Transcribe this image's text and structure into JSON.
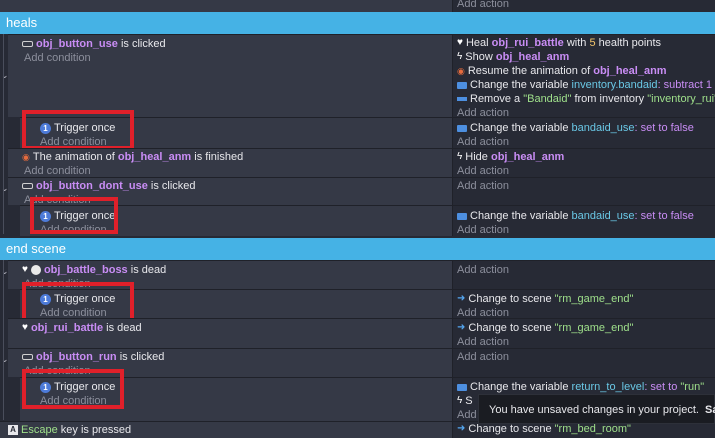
{
  "top_add_action": "Add action",
  "heals": {
    "title": "heals",
    "use_event": {
      "cond_obj": "obj_button_use",
      "cond_text": "is clicked",
      "add_condition": "Add condition",
      "actions": [
        {
          "pre": "Heal",
          "obj": "obj_rui_battle",
          "mid": "with",
          "num": "5",
          "post": "health points"
        },
        {
          "pre": "Show",
          "obj": "obj_heal_anm"
        },
        {
          "pre": "Resume the animation of",
          "obj": "obj_heal_anm"
        },
        {
          "pre": "Change the variable",
          "var": "inventory.bandaid",
          "post": ": subtract 1"
        },
        {
          "pre": "Remove a",
          "str1": "\"Bandaid\"",
          "mid": "from inventory",
          "str2": "\"inventory_rui\""
        }
      ],
      "add_action": "Add action"
    },
    "trigger1": {
      "label": "Trigger once",
      "add_condition": "Add condition",
      "action_pre": "Change the variable",
      "action_var": "bandaid_use",
      "action_post": ": set to false",
      "add_action": "Add action"
    },
    "anim_event": {
      "pre": "The animation of",
      "obj": "obj_heal_anm",
      "post": "is finished",
      "add_condition": "Add condition",
      "action_pre": "Hide",
      "action_obj": "obj_heal_anm",
      "add_action": "Add action"
    },
    "dont_use_event": {
      "cond_obj": "obj_button_dont_use",
      "cond_text": "is clicked",
      "add_condition": "Add condition",
      "add_action": "Add action"
    },
    "trigger2": {
      "label": "Trigger once",
      "add_condition": "Add condition",
      "action_pre": "Change the variable",
      "action_var": "bandaid_use",
      "action_post": ": set to false",
      "add_action": "Add action"
    }
  },
  "end_scene": {
    "title": "end scene",
    "boss_event": {
      "obj": "obj_battle_boss",
      "post": "is dead",
      "add_condition": "Add condition",
      "add_action": "Add action"
    },
    "trigger3": {
      "label": "Trigger once",
      "add_condition": "Add condition",
      "action_pre": "Change to scene",
      "action_str": "\"rm_game_end\"",
      "add_action": "Add action"
    },
    "rui_event": {
      "obj": "obj_rui_battle",
      "post": "is dead",
      "action_pre": "Change to scene",
      "action_str": "\"rm_game_end\"",
      "add_action": "Add action"
    },
    "run_event": {
      "cond_obj": "obj_button_run",
      "cond_text": "is clicked",
      "add_condition": "Add condition",
      "add_action": "Add action"
    },
    "trigger4": {
      "label": "Trigger once",
      "add_condition": "Add condition",
      "action_pre": "Change the variable",
      "action_var": "return_to_level",
      "action_post": ": set to",
      "action_str": "\"run\"",
      "action2_pre": "S",
      "add_action": "Add"
    },
    "escape_event": {
      "key": "Escape",
      "post": "key is pressed",
      "action_pre": "Change to scene",
      "action_str": "\"rm_bed_room\""
    }
  },
  "toast": {
    "message": "You have unsaved changes in your project.",
    "button": "Sa"
  },
  "colors": {
    "section_bg": "#45b2e5",
    "highlight_box": "#e0202a",
    "object_name": "#c98df5",
    "variable": "#6ac8e6",
    "string": "#9fe08b"
  }
}
